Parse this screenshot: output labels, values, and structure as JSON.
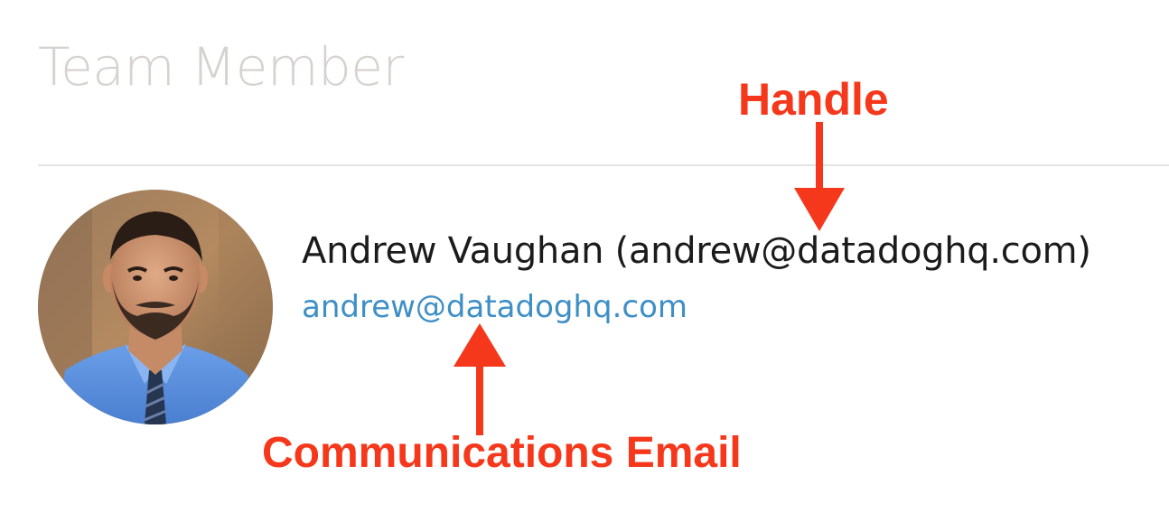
{
  "page": {
    "title": "Team Member"
  },
  "member": {
    "display_name": "Andrew Vaughan (andrew@datadoghq.com)",
    "email": "andrew@datadoghq.com"
  },
  "annotations": {
    "handle_label": "Handle",
    "email_label": "Communications Email",
    "color": "#f5381b"
  },
  "colors": {
    "title": "#d6d2d0",
    "link": "#3e8fc6",
    "name": "#1b1b1b",
    "divider": "#e3e3e3"
  }
}
